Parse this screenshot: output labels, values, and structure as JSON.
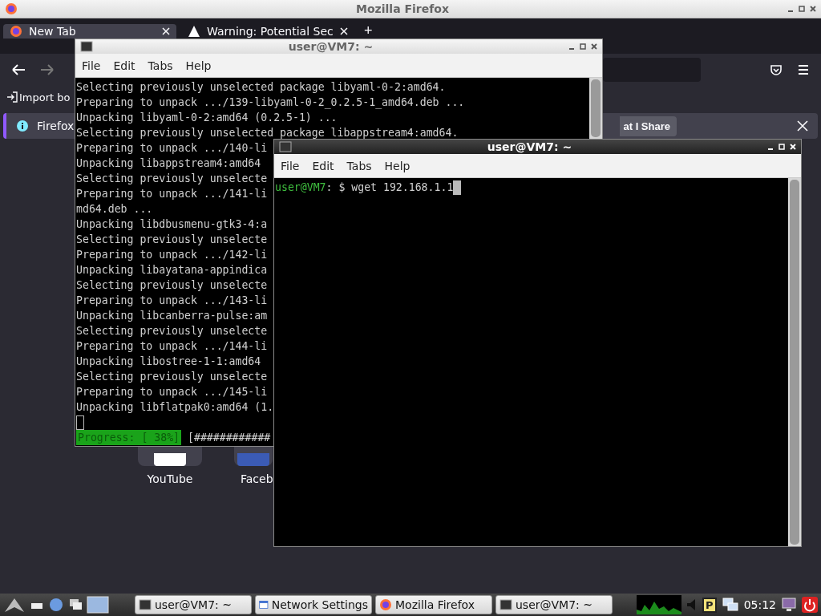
{
  "firefox": {
    "title": "Mozilla Firefox",
    "tabs": [
      {
        "label": "New Tab",
        "kind": "firefox",
        "selected": true
      },
      {
        "label": "Warning: Potential Sec",
        "kind": "warning",
        "selected": false
      }
    ],
    "new_tab_button": "+",
    "bookmarks": [
      "Import bo"
    ],
    "notification": {
      "text": "Firefox",
      "button": "at I Share"
    },
    "shortcuts": [
      {
        "label": "YouTube",
        "color": "#ffffff"
      },
      {
        "label": "Faceb",
        "color": "#3b5bb5"
      }
    ]
  },
  "terminals": [
    {
      "title": "user@VM7: ~",
      "active": false,
      "menu": [
        "File",
        "Edit",
        "Tabs",
        "Help"
      ],
      "lines": [
        "Selecting previously unselected package libyaml-0-2:amd64.",
        "Preparing to unpack .../139-libyaml-0-2_0.2.5-1_amd64.deb ...",
        "Unpacking libyaml-0-2:amd64 (0.2.5-1) ...",
        "Selecting previously unselected package libappstream4:amd64.",
        "Preparing to unpack .../140-li",
        "Unpacking libappstream4:amd64",
        "Selecting previously unselecte",
        "Preparing to unpack .../141-li",
        "md64.deb ...",
        "Unpacking libdbusmenu-gtk3-4:a",
        "Selecting previously unselecte",
        "Preparing to unpack .../142-li",
        "Unpacking libayatana-appindica",
        "Selecting previously unselecte",
        "Preparing to unpack .../143-li",
        "Unpacking libcanberra-pulse:am",
        "Selecting previously unselecte",
        "Preparing to unpack .../144-li",
        "Unpacking libostree-1-1:amd64",
        "Selecting previously unselecte",
        "Preparing to unpack .../145-li",
        "Unpacking libflatpak0:amd64 (1."
      ],
      "progress": {
        "label": "Progress: [ 38%]",
        "bar": "[############"
      }
    },
    {
      "title": "user@VM7: ~",
      "active": true,
      "menu": [
        "File",
        "Edit",
        "Tabs",
        "Help"
      ],
      "prompt": {
        "user": "user@VM7",
        "command": ": $ wget 192.168.1.1"
      }
    }
  ],
  "taskbar": {
    "tasks": [
      {
        "label": "user@VM7: ~",
        "kind": "terminal"
      },
      {
        "label": "Network Settings",
        "kind": "window"
      },
      {
        "label": "Mozilla Firefox",
        "kind": "firefox"
      },
      {
        "label": "user@VM7: ~",
        "kind": "terminal"
      }
    ],
    "indicator": "P",
    "clock": "05:12"
  }
}
